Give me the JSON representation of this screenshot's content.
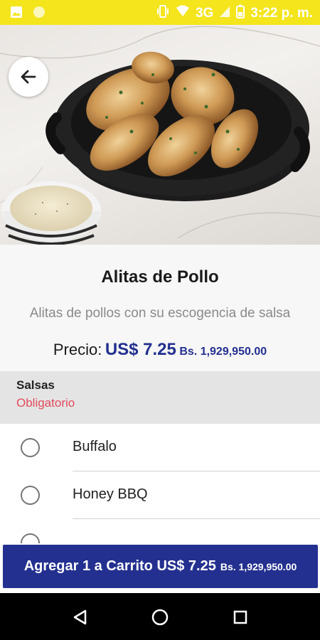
{
  "status_bar": {
    "network": "3G",
    "time": "3:22 p. m."
  },
  "product": {
    "name": "Alitas de Pollo",
    "description": "Alitas de pollos con su escogencia de salsa",
    "price_label": "Precio:",
    "price_usd": "US$ 7.25",
    "price_bs": "Bs. 1,929,950.00"
  },
  "section": {
    "title": "Salsas",
    "required_label": "Obligatorio"
  },
  "options": [
    {
      "label": "Buffalo"
    },
    {
      "label": "Honey BBQ"
    }
  ],
  "cart_button": {
    "label": "Agregar 1 a Carrito US$ 7.25",
    "bs": "Bs. 1,929,950.00"
  },
  "colors": {
    "status_bar": "#f4e51d",
    "accent": "#23308f",
    "required": "#e24a5d"
  }
}
